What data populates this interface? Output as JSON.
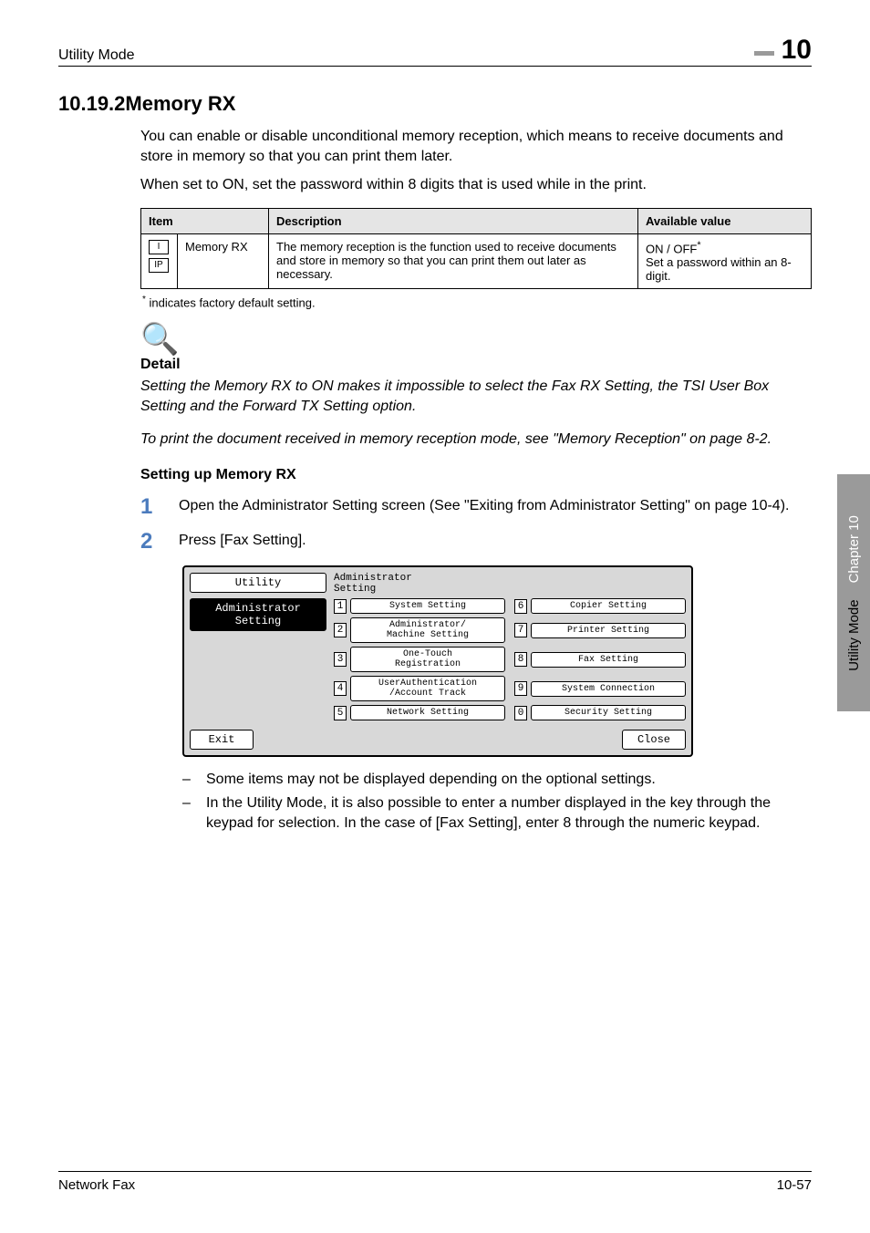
{
  "header": {
    "title": "Utility Mode",
    "chapter_number": "10"
  },
  "section": {
    "number_title": "10.19.2Memory RX",
    "intro1": "You can enable or disable unconditional memory reception, which means to receive documents and store in memory so that you can print them later.",
    "intro2": "When set to ON, set the password within 8 digits that is used while in the print."
  },
  "table": {
    "headers": {
      "item": "Item",
      "description": "Description",
      "value": "Available value"
    },
    "row": {
      "icons": [
        "I",
        "IP"
      ],
      "item": "Memory RX",
      "description": "The memory reception is the function used to receive documents and store in memory so that you can print them out later as necessary.",
      "value_line1": "ON / OFF",
      "value_line2": "Set a password within an 8-digit."
    },
    "footnote_marker": "*",
    "footnote_text": " indicates factory default setting."
  },
  "detail": {
    "label": "Detail",
    "line1": "Setting the Memory RX to ON makes it impossible to select the Fax RX Setting, the TSI User Box Setting and the Forward TX Setting option.",
    "line2": "To print the document received in memory reception mode, see \"Memory Reception\" on page 8-2."
  },
  "setup": {
    "subhead": "Setting up Memory RX",
    "step1_num": "1",
    "step1_text": "Open the Administrator Setting screen (See \"Exiting from Administrator Setting\" on page 10-4).",
    "step2_num": "2",
    "step2_text": "Press [Fax Setting]."
  },
  "panel": {
    "left_tab": "Utility",
    "left_active": "Administrator\nSetting",
    "exit": "Exit",
    "title_top": "Administrator",
    "title_bottom": "Setting",
    "buttons": [
      {
        "n": "1",
        "label": "System Setting"
      },
      {
        "n": "6",
        "label": "Copier Setting"
      },
      {
        "n": "2",
        "label": "Administrator/\nMachine Setting"
      },
      {
        "n": "7",
        "label": "Printer Setting"
      },
      {
        "n": "3",
        "label": "One-Touch\nRegistration"
      },
      {
        "n": "8",
        "label": "Fax Setting"
      },
      {
        "n": "4",
        "label": "UserAuthentication\n/Account Track"
      },
      {
        "n": "9",
        "label": "System Connection"
      },
      {
        "n": "5",
        "label": "Network Setting"
      },
      {
        "n": "0",
        "label": "Security Setting"
      }
    ],
    "close": "Close"
  },
  "notes": {
    "n1": "Some items may not be displayed depending on the optional settings.",
    "n2": "In the Utility Mode, it is also possible to enter a number displayed in the key through the keypad for selection. In the case of [Fax Setting], enter 8 through the numeric keypad."
  },
  "side": {
    "text1": "Utility Mode",
    "text2": "Chapter 10"
  },
  "footer": {
    "left": "Network Fax",
    "right": "10-57"
  }
}
